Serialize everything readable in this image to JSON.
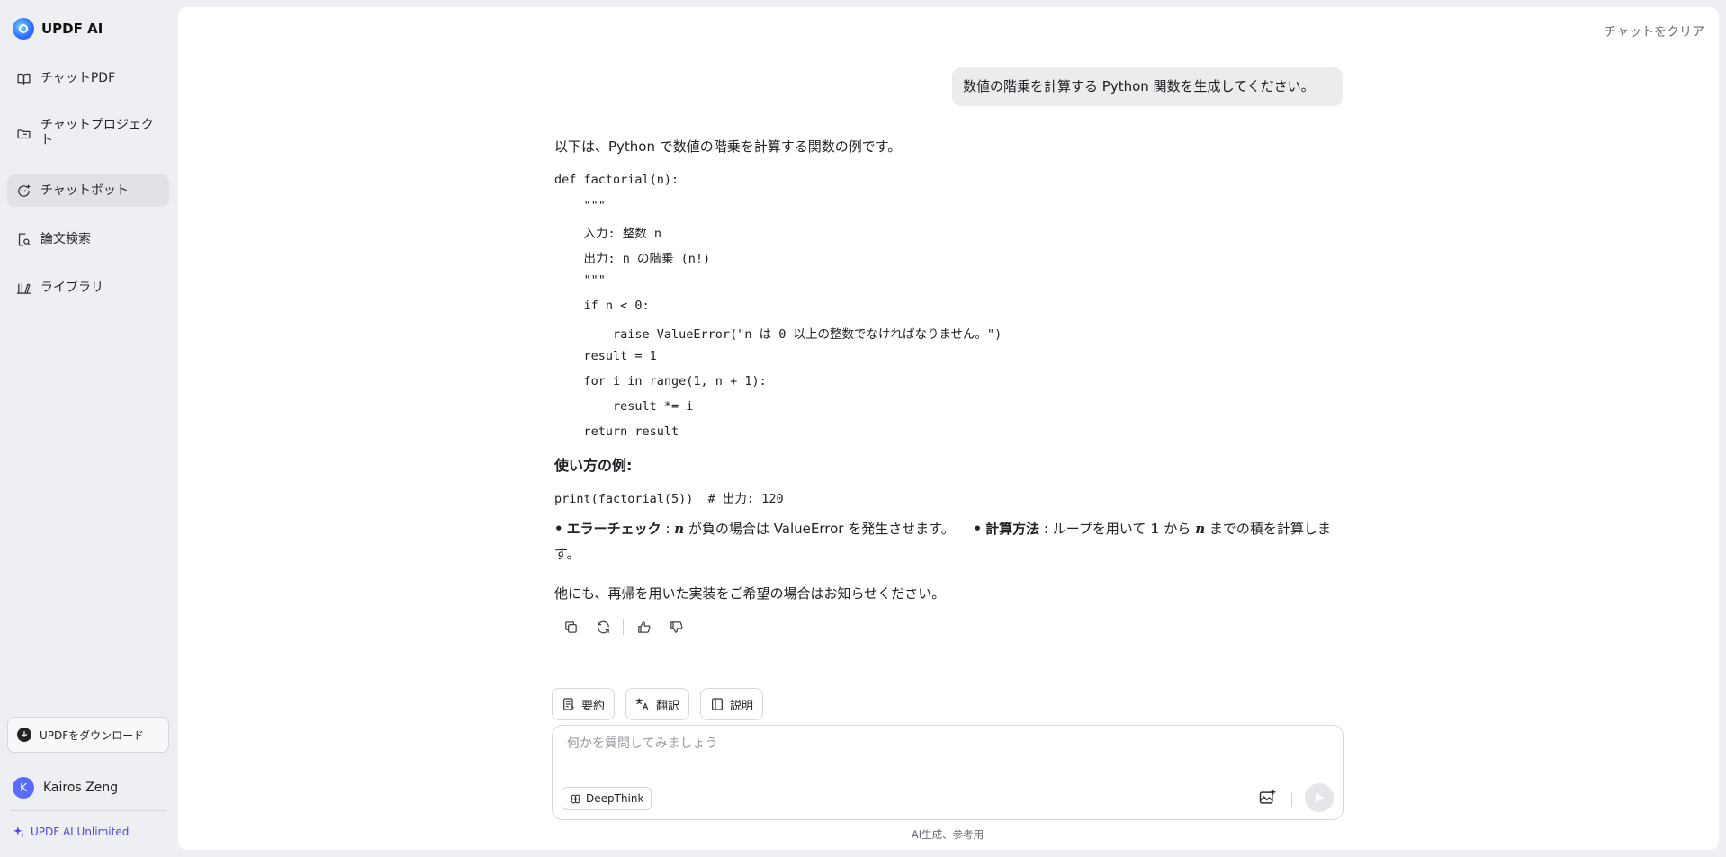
{
  "brand": {
    "name": "UPDF AI"
  },
  "sidebar": {
    "items": [
      {
        "label": "チャットPDF",
        "icon": "book-open-icon",
        "active": false
      },
      {
        "label": "チャットプロジェクト",
        "icon": "folder-icon",
        "active": false
      },
      {
        "label": "チャットボット",
        "icon": "chatbot-icon",
        "active": true
      },
      {
        "label": "論文検索",
        "icon": "paper-search-icon",
        "active": false
      },
      {
        "label": "ライブラリ",
        "icon": "library-icon",
        "active": false
      }
    ],
    "download_label": "UPDFをダウンロード",
    "user": {
      "initial": "K",
      "name": "Kairos Zeng"
    },
    "plan_label": "UPDF AI Unlimited"
  },
  "header": {
    "clear_label": "チャットをクリア"
  },
  "chat": {
    "user_message": "数値の階乗を計算する Python 関数を生成してください。",
    "intro": "以下は、Python で数値の階乗を計算する関数の例です。",
    "code_lines": [
      "def factorial(n):",
      "    \"\"\"",
      "    入力: 整数 n",
      "    出力: n の階乗 (n!)",
      "    \"\"\"",
      "    if n < 0:",
      "        raise ValueError(\"n は 0 以上の整数でなければなりません。\")",
      "    result = 1",
      "    for i in range(1, n + 1):",
      "        result *= i",
      "    return result"
    ],
    "usage_title": "使い方の例:",
    "usage_code": "print(factorial(5))  # 出力: 120",
    "bullet1_title": "エラーチェック",
    "bullet1_sep": ":",
    "bullet1_var": "n",
    "bullet1_text": "が負の場合は ValueError を発生させます。",
    "bullet2_title": "計算方法",
    "bullet2_sep": ":",
    "bullet2_text_a": "ループを用いて",
    "bullet2_one": "1",
    "bullet2_text_b": "から",
    "bullet2_var": "n",
    "bullet2_text_c": "までの積を計算します。",
    "closing": "他にも、再帰を用いた実装をご希望の場合はお知らせください。"
  },
  "quick_actions": [
    {
      "label": "要約",
      "icon": "summary-icon"
    },
    {
      "label": "翻訳",
      "icon": "translate-icon"
    },
    {
      "label": "説明",
      "icon": "explain-icon"
    }
  ],
  "composer": {
    "placeholder": "何かを質問してみましょう",
    "deepthink_label": "DeepThink"
  },
  "footer": {
    "note": "AI生成、参考用"
  },
  "colors": {
    "accent": "#4f46e5",
    "active_bg": "#e1e2e6",
    "bubble_bg": "#ececef"
  }
}
